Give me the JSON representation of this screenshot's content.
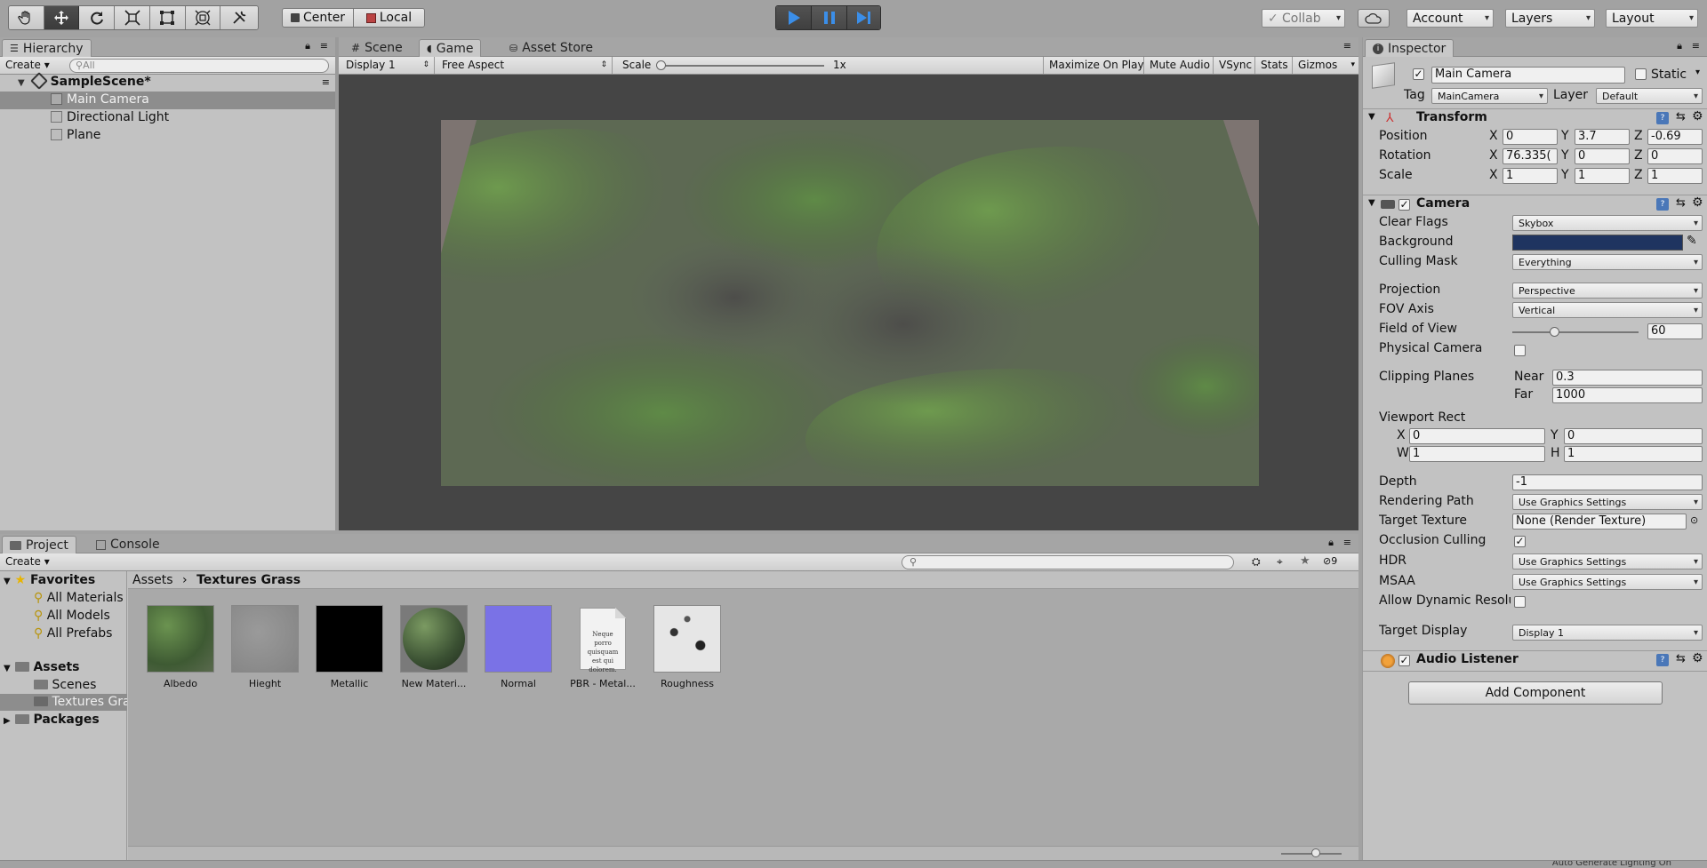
{
  "toolbar": {
    "pivot_center": "Center",
    "pivot_local": "Local",
    "collab": "Collab",
    "account": "Account",
    "layers": "Layers",
    "layout": "Layout",
    "tools": [
      "hand-tool-icon",
      "move-tool-icon",
      "rotate-tool-icon",
      "scale-tool-icon",
      "rect-tool-icon",
      "transform-tool-icon",
      "custom-tool-icon"
    ],
    "accent": "#3b8ee8"
  },
  "hierarchy": {
    "tab": "Hierarchy",
    "create": "Create",
    "search_placeholder": "All",
    "scene": "SampleScene*",
    "items": [
      "Main Camera",
      "Directional Light",
      "Plane"
    ]
  },
  "center_tabs": {
    "scene": "Scene",
    "game": "Game",
    "asset_store": "Asset Store"
  },
  "game": {
    "display": "Display 1",
    "aspect": "Free Aspect",
    "scale_label": "Scale",
    "scale_value": "1x",
    "maximize": "Maximize On Play",
    "mute": "Mute Audio",
    "vsync": "VSync",
    "stats": "Stats",
    "gizmos": "Gizmos"
  },
  "project": {
    "tab": "Project",
    "console_tab": "Console",
    "create": "Create",
    "favorites": "Favorites",
    "fav_items": [
      "All Materials",
      "All Models",
      "All Prefabs"
    ],
    "assets": "Assets",
    "asset_folders": [
      "Scenes",
      "Textures Grass"
    ],
    "packages": "Packages",
    "hidden_count": "9",
    "breadcrumb_root": "Assets",
    "breadcrumb_current": "Textures Grass",
    "files": [
      "Albedo",
      "Hieght",
      "Metallic",
      "New Materi...",
      "Normal",
      "PBR - Metal...",
      "Roughness"
    ],
    "doc_text": "Neque porro quisquam est qui dolorem."
  },
  "inspector": {
    "tab": "Inspector",
    "object_name": "Main Camera",
    "static": "Static",
    "tag_label": "Tag",
    "tag": "MainCamera",
    "layer_label": "Layer",
    "layer": "Default",
    "transform": {
      "title": "Transform",
      "position_label": "Position",
      "rotation_label": "Rotation",
      "scale_label": "Scale",
      "position": [
        "0",
        "3.7",
        "-0.69"
      ],
      "rotation": [
        "76.335(",
        "0",
        "0"
      ],
      "scale": [
        "1",
        "1",
        "1"
      ]
    },
    "camera": {
      "title": "Camera",
      "clear_flags_label": "Clear Flags",
      "clear_flags": "Skybox",
      "background_label": "Background",
      "background_color": "#1f3460",
      "culling_mask_label": "Culling Mask",
      "culling_mask": "Everything",
      "projection_label": "Projection",
      "projection": "Perspective",
      "fov_axis_label": "FOV Axis",
      "fov_axis": "Vertical",
      "fov_label": "Field of View",
      "fov": "60",
      "fov_fraction": 0.33,
      "physical_label": "Physical Camera",
      "clipping_label": "Clipping Planes",
      "near_label": "Near",
      "near": "0.3",
      "far_label": "Far",
      "far": "1000",
      "viewport_label": "Viewport Rect",
      "vp_x": "0",
      "vp_y": "0",
      "vp_w": "1",
      "vp_h": "1",
      "depth_label": "Depth",
      "depth": "-1",
      "rendering_label": "Rendering Path",
      "rendering": "Use Graphics Settings",
      "target_texture_label": "Target Texture",
      "target_texture": "None (Render Texture)",
      "occlusion_label": "Occlusion Culling",
      "hdr_label": "HDR",
      "hdr": "Use Graphics Settings",
      "msaa_label": "MSAA",
      "msaa": "Use Graphics Settings",
      "dynamic_label": "Allow Dynamic Resolu",
      "target_display_label": "Target Display",
      "target_display": "Display 1"
    },
    "audio_listener": "Audio Listener",
    "add_component": "Add Component"
  },
  "status": {
    "text": "Auto Generate Lighting On"
  }
}
